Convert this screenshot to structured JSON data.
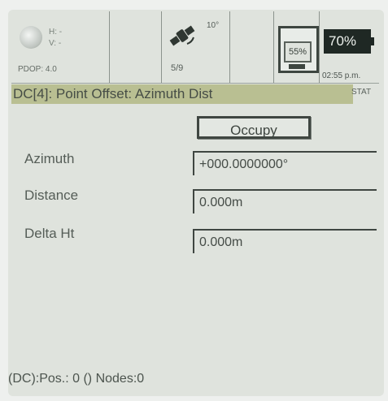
{
  "status": {
    "h_label": "H: -",
    "v_label": "V: -",
    "pdop": "PDOP: 4.0",
    "angle": "10°",
    "satellites": "5/9",
    "storage": "55%",
    "battery": "70%",
    "time": "02:55 p.m."
  },
  "title": "DC[4]: Point Offset: Azimuth Dist",
  "stat_label": "STAT",
  "occupy_label": "Occupy",
  "fields": {
    "azimuth": {
      "label": "Azimuth",
      "value": "+000.0000000°"
    },
    "distance": {
      "label": "Distance",
      "value": "0.000m"
    },
    "delta_ht": {
      "label": "Delta Ht",
      "value": "0.000m"
    }
  },
  "footer": "(DC):Pos.: 0 () Nodes:0",
  "colors": {
    "screen": "#dfe3dd",
    "titlebar": "#b9bf92",
    "text": "#454c47",
    "battery_fill": "#1f2824"
  }
}
